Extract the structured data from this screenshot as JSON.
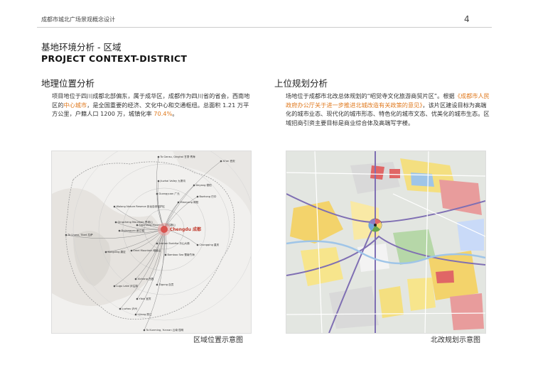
{
  "header": {
    "doc_title": "成都市城北广场景观概念设计",
    "page_number": "4"
  },
  "title": {
    "cn": "基地环境分析 - 区域",
    "en": "PROJECT CONTEXT-DISTRICT"
  },
  "left_section": {
    "title": "地理位置分析",
    "text_1": "项目地位于四川成都北部偏东，属于成华区，成都作为四川省的省会，西南地区的",
    "highlight_1": "中心城市",
    "text_2": "，是全国重要的经济、文化中心和交通枢纽。总面积 1.21 万平方公里，户籍人口 1200 万，城镇化率 ",
    "highlight_2": "70.4%",
    "text_3": "。",
    "caption": "区域位置示意图",
    "map": {
      "hub_label": "Chengdu 成都",
      "destinations": [
        "To Gansu, Qinghai 甘肃·青海",
        "Xi'an 西安",
        "Jiuzhai Valley 九寨沟",
        "Guangyuan 广元",
        "Mianyang 绵阳",
        "Bazhong 巴中",
        "Wolong Nature Reserve 卧龙自然保护区",
        "To Lhasa, Tibet 拉萨",
        "Deyang 德阳",
        "Qingcheng Mountain 青城山",
        "Dujiangyan 都江堰",
        "Siguniang Mountain 四姑娘山",
        "Emei Mountain 峨眉山",
        "Chongqing 重庆",
        "Leshan Buddha 乐山大佛",
        "Kangding 康定",
        "Bamboo Sea 蜀南竹海",
        "Xichang 西昌",
        "Lugu Lake 泸沽湖",
        "Zigong 自贡",
        "Yibin 宜宾",
        "Luzhou 泸州",
        "Lijiang 丽江",
        "To Kunming, Yunnan 云南·昆明"
      ]
    }
  },
  "right_section": {
    "title": "上位规划分析",
    "text_1": "场地位于成都市北改总体规划的“昭觉寺文化旅游商贸片区”。根据",
    "highlight_1": "《成都市人民政府办公厅关于进一步推进北城改造有关政策的意见》",
    "text_2": "，该片区建设目标为高端化的城市业态、现代化的城市形态、特色化的城市文态、优美化的城市生态。区域招商引资主要目标是商业综合体及高端写字楼。",
    "caption": "北改规划示意图"
  }
}
